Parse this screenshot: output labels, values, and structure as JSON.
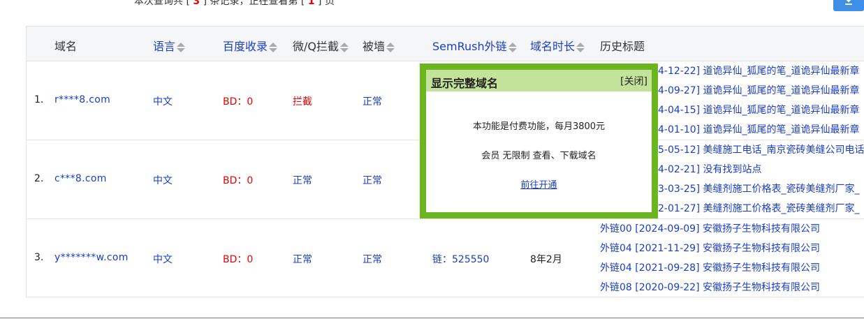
{
  "summary": {
    "prefix": "本次查询共 [ ",
    "total": "3",
    "middle": " ] 条记录，正在查看第 [ ",
    "page": "1",
    "suffix": " ] 页"
  },
  "toolbar": {
    "download_icon": "download-icon",
    "accent": "#3d8fe8"
  },
  "headers": {
    "domain": "域名",
    "lang": "语言",
    "baidu": "百度收录",
    "wq": "微/Q拦截",
    "wall": "被墙",
    "semrush": "SemRush外链",
    "age": "域名时长",
    "history": "历史标题"
  },
  "rows": [
    {
      "idx": "1.",
      "domain": "r****8.com",
      "lang": "中文",
      "bd": "BD：0",
      "wq": "拦截",
      "wall": "正常",
      "sem": "",
      "age": "",
      "history": [
        "4-12-22] 道诡异仙_狐尾的笔_道诡异仙最新章",
        "4-09-27] 道诡异仙_狐尾的笔_道诡异仙最新章",
        "4-04-15] 道诡异仙_狐尾的笔_道诡异仙最新章",
        "4-01-10] 道诡异仙_狐尾的笔_道诡异仙最新章"
      ]
    },
    {
      "idx": "2.",
      "domain": "c***8.com",
      "lang": "中文",
      "bd": "BD：0",
      "wq": "正常",
      "wall": "正常",
      "sem": "",
      "age": "",
      "history": [
        "5-05-12] 美缝施工电话_南京瓷砖美缝公司电话",
        "4-02-21] 没有找到站点",
        "3-03-25] 美缝剂施工价格表_瓷砖美缝剂厂家_",
        "2-01-27] 美缝剂施工价格表_瓷砖美缝剂厂家_"
      ]
    },
    {
      "idx": "3.",
      "domain": "y*******w.com",
      "lang": "中文",
      "bd": "BD：0",
      "wq": "正常",
      "wall": "正常",
      "sem": "链：525550",
      "age": "8年2月",
      "history": [
        "外链00 [2024-09-09] 安徽扬子生物科技有限公司",
        "外链04 [2021-11-29] 安徽扬子生物科技有限公司",
        "外链04 [2021-09-28] 安徽扬子生物科技有限公司",
        "外链08 [2020-09-22] 安徽扬子生物科技有限公司"
      ]
    }
  ],
  "popup": {
    "title": "显示完整域名",
    "close": "[关闭]",
    "line1": "本功能是付费功能，每月3800元",
    "line2": "会员 无限制 查看、下载域名",
    "link": "前往开通"
  }
}
